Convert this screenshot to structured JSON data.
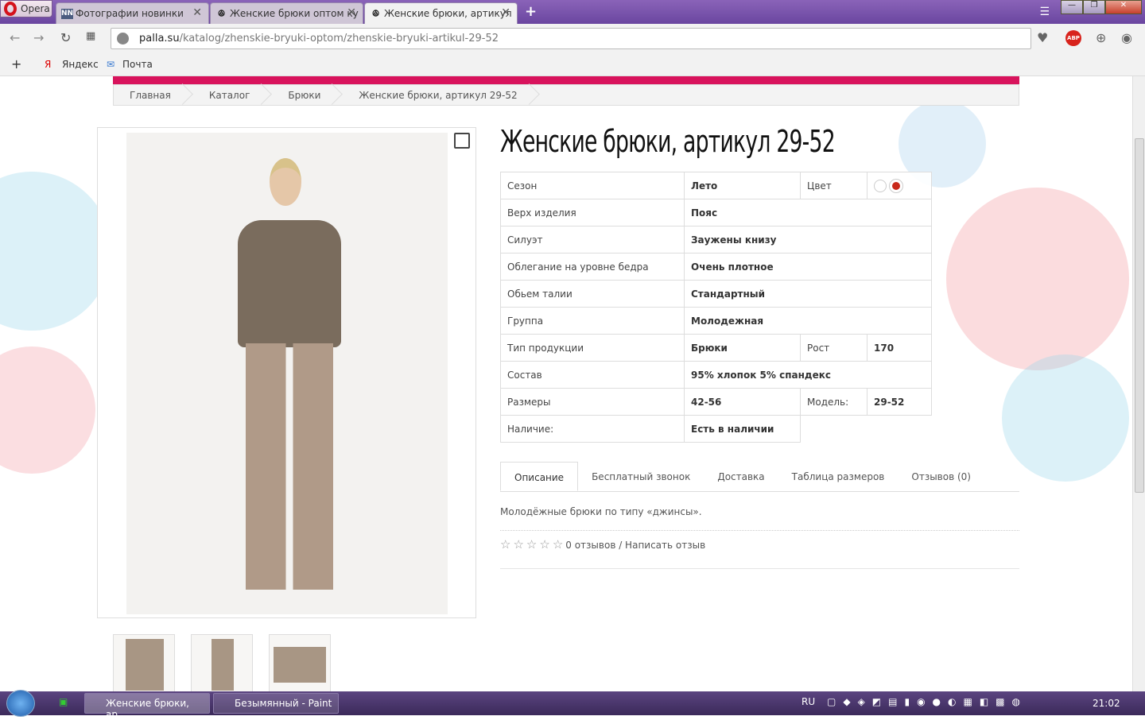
{
  "browser": {
    "opera_label": "Opera",
    "tabs": [
      {
        "label": "Фотографии новинки",
        "icon": "NN"
      },
      {
        "label": "Женские брюки оптом ку"
      },
      {
        "label": "Женские брюки, артикул"
      }
    ],
    "url_domain": "palla.su",
    "url_path": "/katalog/zhenskie-bryuki-optom/zhenskie-bryuki-artikul-29-52",
    "bookmarks": [
      "Яндекс",
      "Почта"
    ],
    "abp": "ABP"
  },
  "breadcrumb": [
    "Главная",
    "Каталог",
    "Брюки",
    "Женские брюки, артикул 29-52"
  ],
  "product": {
    "title": "Женские брюки, артикул 29-52",
    "props": [
      {
        "label": "Сезон",
        "value": "Лето",
        "label2": "Цвет",
        "colors": [
          "#ffffff",
          "#c8281a"
        ]
      },
      {
        "label": "Верх изделия",
        "value": "Пояс"
      },
      {
        "label": "Силуэт",
        "value": "Заужены книзу"
      },
      {
        "label": "Облегание на уровне бедра",
        "value": "Очень плотное"
      },
      {
        "label": "Обьем талии",
        "value": "Стандартный"
      },
      {
        "label": "Группа",
        "value": "Молодежная"
      },
      {
        "label": "Тип продукции",
        "value": "Брюки",
        "label2": "Рост",
        "value2": "170"
      },
      {
        "label": "Состав",
        "value": "95% хлопок 5% спандекс"
      },
      {
        "label": "Размеры",
        "value": "42-56",
        "label2": "Модель:",
        "value2": "29-52"
      },
      {
        "label": "Наличие:",
        "value": "Есть в наличии"
      }
    ],
    "tabs": [
      "Описание",
      "Бесплатный звонок",
      "Доставка",
      "Таблица размеров",
      "Отзывов (0)"
    ],
    "description": "Молодёжные брюки по типу «джинсы».",
    "rating": 0,
    "reviews_text": "0 отзывов / Написать отзыв"
  },
  "taskbar": {
    "items": [
      "Женские брюки, ар...",
      "Безымянный - Paint"
    ],
    "lang": "RU",
    "clock": "21:02"
  },
  "colors": {
    "accent": "#d8135c",
    "taskbar": "#4a3670"
  }
}
